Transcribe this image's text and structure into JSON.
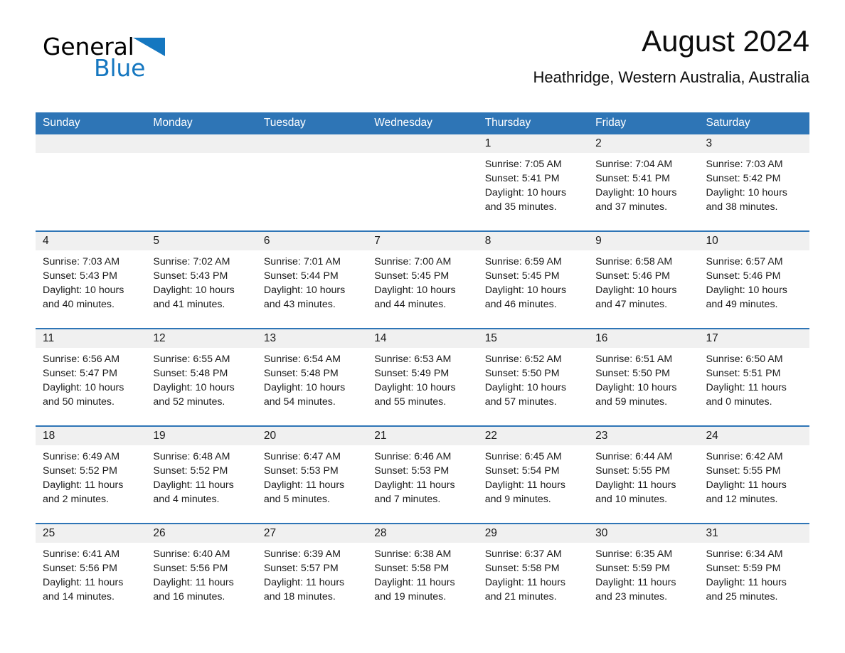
{
  "brand": {
    "word1": "General",
    "word2": "Blue",
    "triangle_color": "#1577c0"
  },
  "header": {
    "title": "August 2024",
    "subtitle": "Heathridge, Western Australia, Australia",
    "accent_color": "#2e75b6",
    "date_band_color": "#f0f0f0"
  },
  "weekdays": [
    "Sunday",
    "Monday",
    "Tuesday",
    "Wednesday",
    "Thursday",
    "Friday",
    "Saturday"
  ],
  "labels": {
    "sunrise_prefix": "Sunrise:",
    "sunset_prefix": "Sunset:",
    "daylight_prefix": "Daylight:"
  },
  "weeks": [
    {
      "dates": [
        "",
        "",
        "",
        "",
        "1",
        "2",
        "3"
      ],
      "cells": [
        {
          "empty": true,
          "lines": [
            "",
            "",
            "",
            ""
          ]
        },
        {
          "empty": true,
          "lines": [
            "",
            "",
            "",
            ""
          ]
        },
        {
          "empty": true,
          "lines": [
            "",
            "",
            "",
            ""
          ]
        },
        {
          "empty": true,
          "lines": [
            "",
            "",
            "",
            ""
          ]
        },
        {
          "empty": false,
          "lines": [
            "Sunrise: 7:05 AM",
            "Sunset: 5:41 PM",
            "Daylight: 10 hours",
            "and 35 minutes."
          ]
        },
        {
          "empty": false,
          "lines": [
            "Sunrise: 7:04 AM",
            "Sunset: 5:41 PM",
            "Daylight: 10 hours",
            "and 37 minutes."
          ]
        },
        {
          "empty": false,
          "lines": [
            "Sunrise: 7:03 AM",
            "Sunset: 5:42 PM",
            "Daylight: 10 hours",
            "and 38 minutes."
          ]
        }
      ]
    },
    {
      "dates": [
        "4",
        "5",
        "6",
        "7",
        "8",
        "9",
        "10"
      ],
      "cells": [
        {
          "empty": false,
          "lines": [
            "Sunrise: 7:03 AM",
            "Sunset: 5:43 PM",
            "Daylight: 10 hours",
            "and 40 minutes."
          ]
        },
        {
          "empty": false,
          "lines": [
            "Sunrise: 7:02 AM",
            "Sunset: 5:43 PM",
            "Daylight: 10 hours",
            "and 41 minutes."
          ]
        },
        {
          "empty": false,
          "lines": [
            "Sunrise: 7:01 AM",
            "Sunset: 5:44 PM",
            "Daylight: 10 hours",
            "and 43 minutes."
          ]
        },
        {
          "empty": false,
          "lines": [
            "Sunrise: 7:00 AM",
            "Sunset: 5:45 PM",
            "Daylight: 10 hours",
            "and 44 minutes."
          ]
        },
        {
          "empty": false,
          "lines": [
            "Sunrise: 6:59 AM",
            "Sunset: 5:45 PM",
            "Daylight: 10 hours",
            "and 46 minutes."
          ]
        },
        {
          "empty": false,
          "lines": [
            "Sunrise: 6:58 AM",
            "Sunset: 5:46 PM",
            "Daylight: 10 hours",
            "and 47 minutes."
          ]
        },
        {
          "empty": false,
          "lines": [
            "Sunrise: 6:57 AM",
            "Sunset: 5:46 PM",
            "Daylight: 10 hours",
            "and 49 minutes."
          ]
        }
      ]
    },
    {
      "dates": [
        "11",
        "12",
        "13",
        "14",
        "15",
        "16",
        "17"
      ],
      "cells": [
        {
          "empty": false,
          "lines": [
            "Sunrise: 6:56 AM",
            "Sunset: 5:47 PM",
            "Daylight: 10 hours",
            "and 50 minutes."
          ]
        },
        {
          "empty": false,
          "lines": [
            "Sunrise: 6:55 AM",
            "Sunset: 5:48 PM",
            "Daylight: 10 hours",
            "and 52 minutes."
          ]
        },
        {
          "empty": false,
          "lines": [
            "Sunrise: 6:54 AM",
            "Sunset: 5:48 PM",
            "Daylight: 10 hours",
            "and 54 minutes."
          ]
        },
        {
          "empty": false,
          "lines": [
            "Sunrise: 6:53 AM",
            "Sunset: 5:49 PM",
            "Daylight: 10 hours",
            "and 55 minutes."
          ]
        },
        {
          "empty": false,
          "lines": [
            "Sunrise: 6:52 AM",
            "Sunset: 5:50 PM",
            "Daylight: 10 hours",
            "and 57 minutes."
          ]
        },
        {
          "empty": false,
          "lines": [
            "Sunrise: 6:51 AM",
            "Sunset: 5:50 PM",
            "Daylight: 10 hours",
            "and 59 minutes."
          ]
        },
        {
          "empty": false,
          "lines": [
            "Sunrise: 6:50 AM",
            "Sunset: 5:51 PM",
            "Daylight: 11 hours",
            "and 0 minutes."
          ]
        }
      ]
    },
    {
      "dates": [
        "18",
        "19",
        "20",
        "21",
        "22",
        "23",
        "24"
      ],
      "cells": [
        {
          "empty": false,
          "lines": [
            "Sunrise: 6:49 AM",
            "Sunset: 5:52 PM",
            "Daylight: 11 hours",
            "and 2 minutes."
          ]
        },
        {
          "empty": false,
          "lines": [
            "Sunrise: 6:48 AM",
            "Sunset: 5:52 PM",
            "Daylight: 11 hours",
            "and 4 minutes."
          ]
        },
        {
          "empty": false,
          "lines": [
            "Sunrise: 6:47 AM",
            "Sunset: 5:53 PM",
            "Daylight: 11 hours",
            "and 5 minutes."
          ]
        },
        {
          "empty": false,
          "lines": [
            "Sunrise: 6:46 AM",
            "Sunset: 5:53 PM",
            "Daylight: 11 hours",
            "and 7 minutes."
          ]
        },
        {
          "empty": false,
          "lines": [
            "Sunrise: 6:45 AM",
            "Sunset: 5:54 PM",
            "Daylight: 11 hours",
            "and 9 minutes."
          ]
        },
        {
          "empty": false,
          "lines": [
            "Sunrise: 6:44 AM",
            "Sunset: 5:55 PM",
            "Daylight: 11 hours",
            "and 10 minutes."
          ]
        },
        {
          "empty": false,
          "lines": [
            "Sunrise: 6:42 AM",
            "Sunset: 5:55 PM",
            "Daylight: 11 hours",
            "and 12 minutes."
          ]
        }
      ]
    },
    {
      "dates": [
        "25",
        "26",
        "27",
        "28",
        "29",
        "30",
        "31"
      ],
      "cells": [
        {
          "empty": false,
          "lines": [
            "Sunrise: 6:41 AM",
            "Sunset: 5:56 PM",
            "Daylight: 11 hours",
            "and 14 minutes."
          ]
        },
        {
          "empty": false,
          "lines": [
            "Sunrise: 6:40 AM",
            "Sunset: 5:56 PM",
            "Daylight: 11 hours",
            "and 16 minutes."
          ]
        },
        {
          "empty": false,
          "lines": [
            "Sunrise: 6:39 AM",
            "Sunset: 5:57 PM",
            "Daylight: 11 hours",
            "and 18 minutes."
          ]
        },
        {
          "empty": false,
          "lines": [
            "Sunrise: 6:38 AM",
            "Sunset: 5:58 PM",
            "Daylight: 11 hours",
            "and 19 minutes."
          ]
        },
        {
          "empty": false,
          "lines": [
            "Sunrise: 6:37 AM",
            "Sunset: 5:58 PM",
            "Daylight: 11 hours",
            "and 21 minutes."
          ]
        },
        {
          "empty": false,
          "lines": [
            "Sunrise: 6:35 AM",
            "Sunset: 5:59 PM",
            "Daylight: 11 hours",
            "and 23 minutes."
          ]
        },
        {
          "empty": false,
          "lines": [
            "Sunrise: 6:34 AM",
            "Sunset: 5:59 PM",
            "Daylight: 11 hours",
            "and 25 minutes."
          ]
        }
      ]
    }
  ]
}
